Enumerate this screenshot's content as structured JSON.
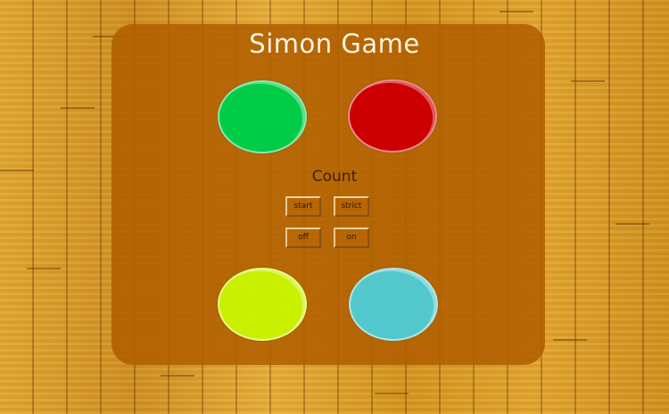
{
  "game": {
    "title": "Simon Game",
    "count_label": "Count",
    "buttons": {
      "start": "start",
      "strict": "strict",
      "off": "off",
      "on": "on"
    },
    "pads": {
      "green": "#00cc48",
      "red": "#cc0000",
      "yellow": "#c8f000",
      "blue": "#52c8cc"
    }
  }
}
